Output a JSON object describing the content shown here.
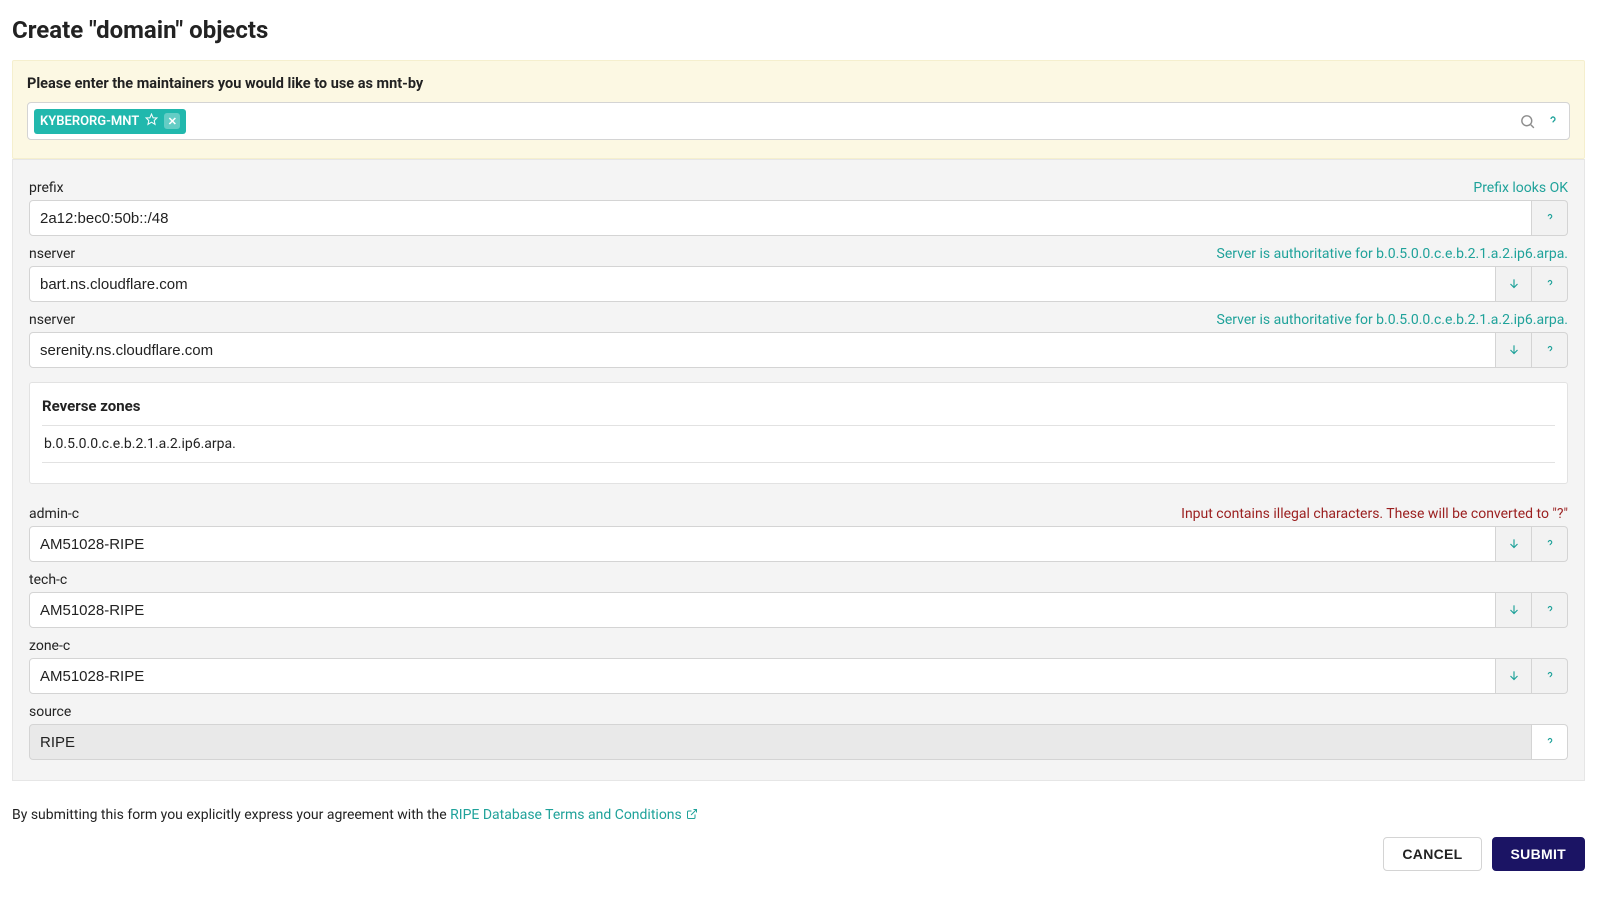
{
  "page": {
    "title": "Create \"domain\" objects"
  },
  "mntby": {
    "label": "Please enter the maintainers you would like to use as mnt-by",
    "tags": [
      {
        "name": "KYBERORG-MNT"
      }
    ]
  },
  "fields": {
    "prefix": {
      "label": "prefix",
      "value": "2a12:bec0:50b::/48",
      "hint": "Prefix looks OK"
    },
    "nserver1": {
      "label": "nserver",
      "value": "bart.ns.cloudflare.com",
      "hint": "Server is authoritative for b.0.5.0.0.c.e.b.2.1.a.2.ip6.arpa."
    },
    "nserver2": {
      "label": "nserver",
      "value": "serenity.ns.cloudflare.com",
      "hint": "Server is authoritative for b.0.5.0.0.c.e.b.2.1.a.2.ip6.arpa."
    },
    "reverse_zones": {
      "title": "Reverse zones",
      "items": [
        "b.0.5.0.0.c.e.b.2.1.a.2.ip6.arpa."
      ]
    },
    "adminc": {
      "label": "admin-c",
      "value": "AM51028-RIPE",
      "hint": "Input contains illegal characters. These will be converted to \"?\""
    },
    "techc": {
      "label": "tech-c",
      "value": "AM51028-RIPE"
    },
    "zonec": {
      "label": "zone-c",
      "value": "AM51028-RIPE"
    },
    "source": {
      "label": "source",
      "value": "RIPE"
    }
  },
  "footer": {
    "terms_prefix": "By submitting this form you explicitly express your agreement with the ",
    "terms_link": "RIPE Database Terms and Conditions",
    "cancel": "CANCEL",
    "submit": "SUBMIT"
  }
}
